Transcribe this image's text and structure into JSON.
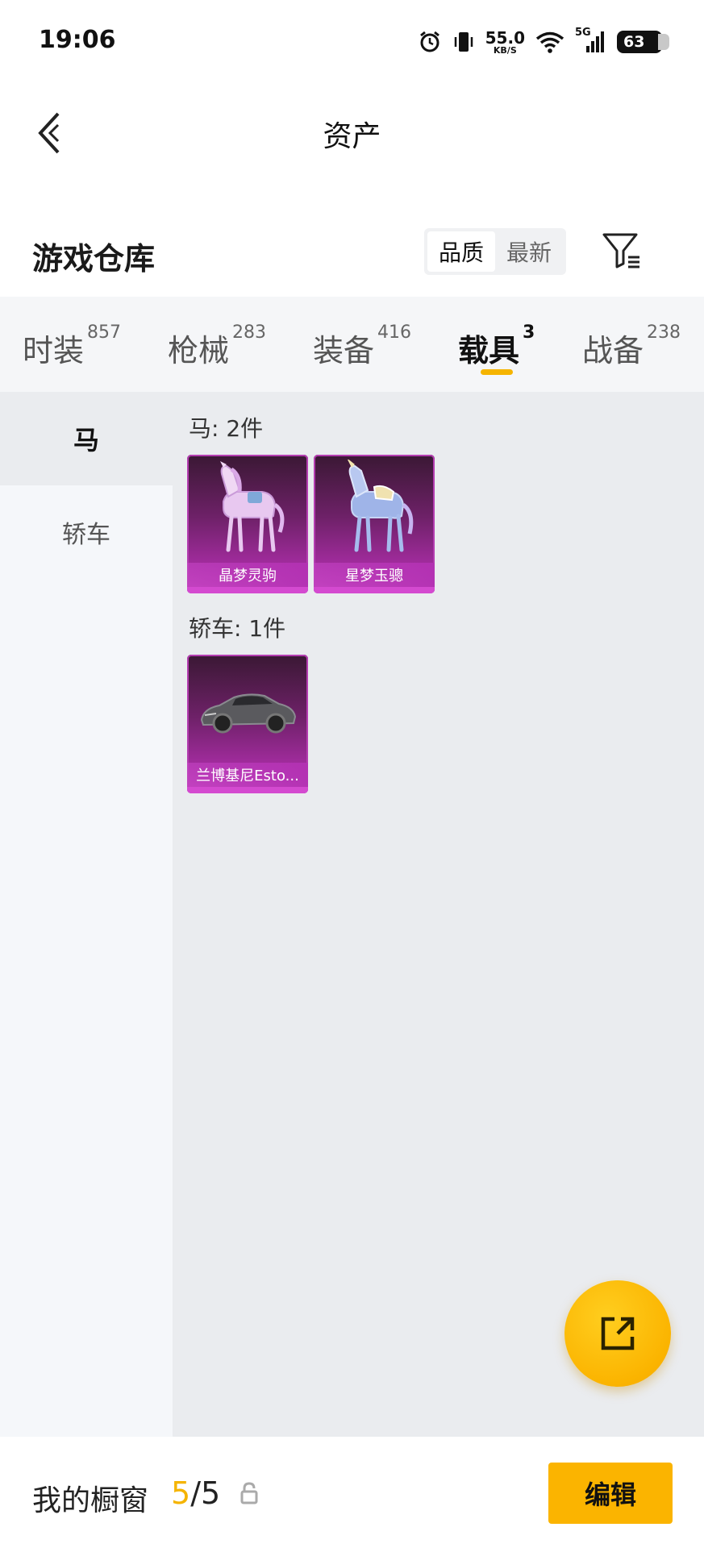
{
  "status_bar": {
    "time": "19:06",
    "net_speed_value": "55.0",
    "net_speed_unit": "KB/S",
    "signal_label": "5G",
    "battery": "63",
    "icons": [
      "alarm-icon",
      "vibrate-icon",
      "wifi-icon",
      "signal-icon",
      "battery-icon"
    ]
  },
  "header": {
    "title": "资产",
    "back_icon": "chevron-left-icon"
  },
  "section": {
    "title": "游戏仓库",
    "sort_options": [
      "品质",
      "最新"
    ],
    "sort_selected": "品质",
    "filter_icon": "filter-icon"
  },
  "tabs": [
    {
      "label": "时装",
      "count": "857"
    },
    {
      "label": "枪械",
      "count": "283"
    },
    {
      "label": "装备",
      "count": "416"
    },
    {
      "label": "载具",
      "count": "3",
      "active": true
    },
    {
      "label": "战备",
      "count": "238"
    }
  ],
  "side_nav": [
    {
      "label": "马",
      "active": true
    },
    {
      "label": "轿车"
    }
  ],
  "groups": [
    {
      "title": "马: 2件",
      "items": [
        {
          "name": "晶梦灵驹",
          "image": "pink-crystal-horse"
        },
        {
          "name": "星梦玉骢",
          "image": "blue-unicorn"
        }
      ]
    },
    {
      "title": "轿车: 1件",
      "items": [
        {
          "name": "兰博基尼Esto...",
          "image": "grey-sports-car"
        }
      ]
    }
  ],
  "fab": {
    "icon": "share-external-icon"
  },
  "bottom_bar": {
    "label": "我的橱窗",
    "current": "5",
    "separator": "/",
    "total": "5",
    "lock_icon": "lock-icon",
    "edit_label": "编辑"
  },
  "colors": {
    "accent": "#f5b400",
    "card_purple": "#a32c9f",
    "content_bg": "#eaecef",
    "tab_bg": "#f5f6f8"
  }
}
